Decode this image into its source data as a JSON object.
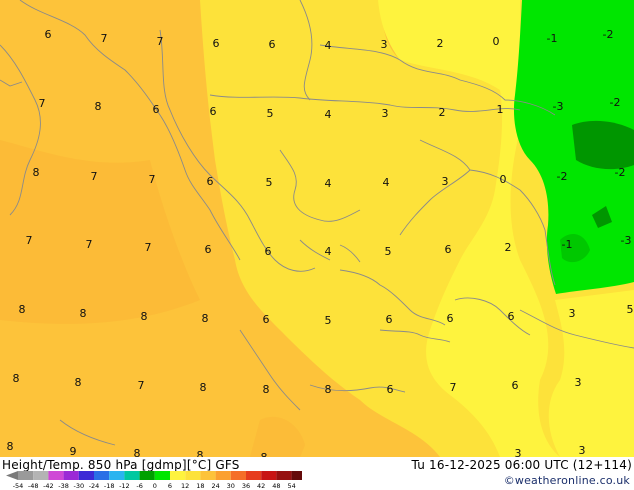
{
  "header": {
    "title": "Height/Temp. 850 hPa [gdmp][°C] GFS",
    "valid_time": "Tu 16-12-2025 06:00 UTC (12+114)",
    "credit": "©weatheronline.co.uk"
  },
  "colors": {
    "warm_orange": "#fdc33a",
    "orange_dark": "#fbb535",
    "yellow_mid": "#fde23a",
    "yellow_light": "#fef33e",
    "green_light": "#00e600",
    "green_mid": "#00c800",
    "green_dark": "#009600",
    "coastline": "#8a8a8a"
  },
  "temperature_labels": [
    {
      "t": "6"
    },
    {
      "t": "7"
    },
    {
      "t": "7"
    },
    {
      "t": "6"
    },
    {
      "t": "6"
    },
    {
      "t": "4"
    },
    {
      "t": "3"
    },
    {
      "t": "2"
    },
    {
      "t": "0"
    },
    {
      "t": "-1"
    },
    {
      "t": "-2"
    },
    {
      "t": "7"
    },
    {
      "t": "8"
    },
    {
      "t": "6"
    },
    {
      "t": "6"
    },
    {
      "t": "5"
    },
    {
      "t": "4"
    },
    {
      "t": "3"
    },
    {
      "t": "2"
    },
    {
      "t": "1"
    },
    {
      "t": "-3"
    },
    {
      "t": "-2"
    },
    {
      "t": "8"
    },
    {
      "t": "7"
    },
    {
      "t": "7"
    },
    {
      "t": "6"
    },
    {
      "t": "5"
    },
    {
      "t": "4"
    },
    {
      "t": "4"
    },
    {
      "t": "3"
    },
    {
      "t": "0"
    },
    {
      "t": "-2"
    },
    {
      "t": "-2"
    },
    {
      "t": "7"
    },
    {
      "t": "7"
    },
    {
      "t": "7"
    },
    {
      "t": "6"
    },
    {
      "t": "6"
    },
    {
      "t": "4"
    },
    {
      "t": "5"
    },
    {
      "t": "6"
    },
    {
      "t": "2"
    },
    {
      "t": "-1"
    },
    {
      "t": "-3"
    },
    {
      "t": "8"
    },
    {
      "t": "8"
    },
    {
      "t": "8"
    },
    {
      "t": "8"
    },
    {
      "t": "6"
    },
    {
      "t": "5"
    },
    {
      "t": "6"
    },
    {
      "t": "6"
    },
    {
      "t": "6"
    },
    {
      "t": "3"
    },
    {
      "t": "5"
    },
    {
      "t": "8"
    },
    {
      "t": "8"
    },
    {
      "t": "7"
    },
    {
      "t": "8"
    },
    {
      "t": "8"
    },
    {
      "t": "8"
    },
    {
      "t": "6"
    },
    {
      "t": "7"
    },
    {
      "t": "6"
    },
    {
      "t": "3"
    },
    {
      "t": "8"
    },
    {
      "t": "9"
    },
    {
      "t": "8"
    },
    {
      "t": "8"
    },
    {
      "t": "8"
    },
    {
      "t": "3"
    },
    {
      "t": "3"
    }
  ],
  "color_scale": {
    "ticks": [
      "-54",
      "-48",
      "-42",
      "-38",
      "-30",
      "-24",
      "-18",
      "-12",
      "-6",
      "0",
      "6",
      "12",
      "18",
      "24",
      "30",
      "36",
      "42",
      "48",
      "54"
    ],
    "colors": [
      "#9a9a9a",
      "#b4b4b4",
      "#cf48d6",
      "#9b2ad6",
      "#3d2ad6",
      "#2a6fe6",
      "#2ab4f0",
      "#00c8a0",
      "#00a000",
      "#00e600",
      "#fef33e",
      "#fde23a",
      "#fdc33a",
      "#fba030",
      "#f56e28",
      "#e63c1e",
      "#c81414",
      "#961010",
      "#640a0a"
    ]
  }
}
